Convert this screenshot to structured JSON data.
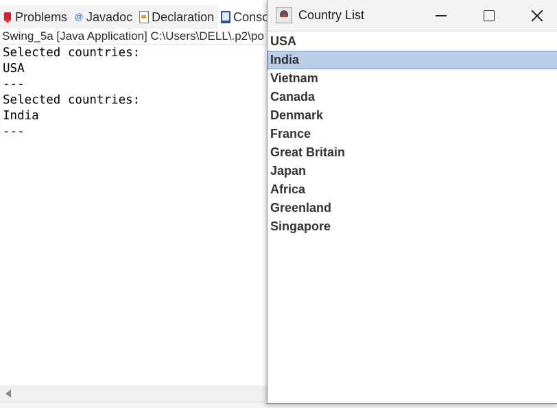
{
  "eclipse": {
    "tabs": [
      {
        "label": "Problems",
        "icon": "problems-icon"
      },
      {
        "label": "Javadoc",
        "icon": "javadoc-icon"
      },
      {
        "label": "Declaration",
        "icon": "declaration-icon"
      },
      {
        "label": "Conso",
        "icon": "console-icon"
      }
    ],
    "launch_info": "Swing_5a [Java Application] C:\\Users\\DELL\\.p2\\po",
    "console_lines": [
      "Selected countries:",
      "USA",
      "---",
      "Selected countries:",
      "India",
      "---"
    ]
  },
  "window": {
    "title": "Country List",
    "countries": [
      "USA",
      "India",
      "Vietnam",
      "Canada",
      "Denmark",
      "France",
      "Great Britain",
      "Japan",
      "Africa",
      "Greenland",
      "Singapore"
    ],
    "selected": "India",
    "selection_color": "#b8cfe5"
  }
}
